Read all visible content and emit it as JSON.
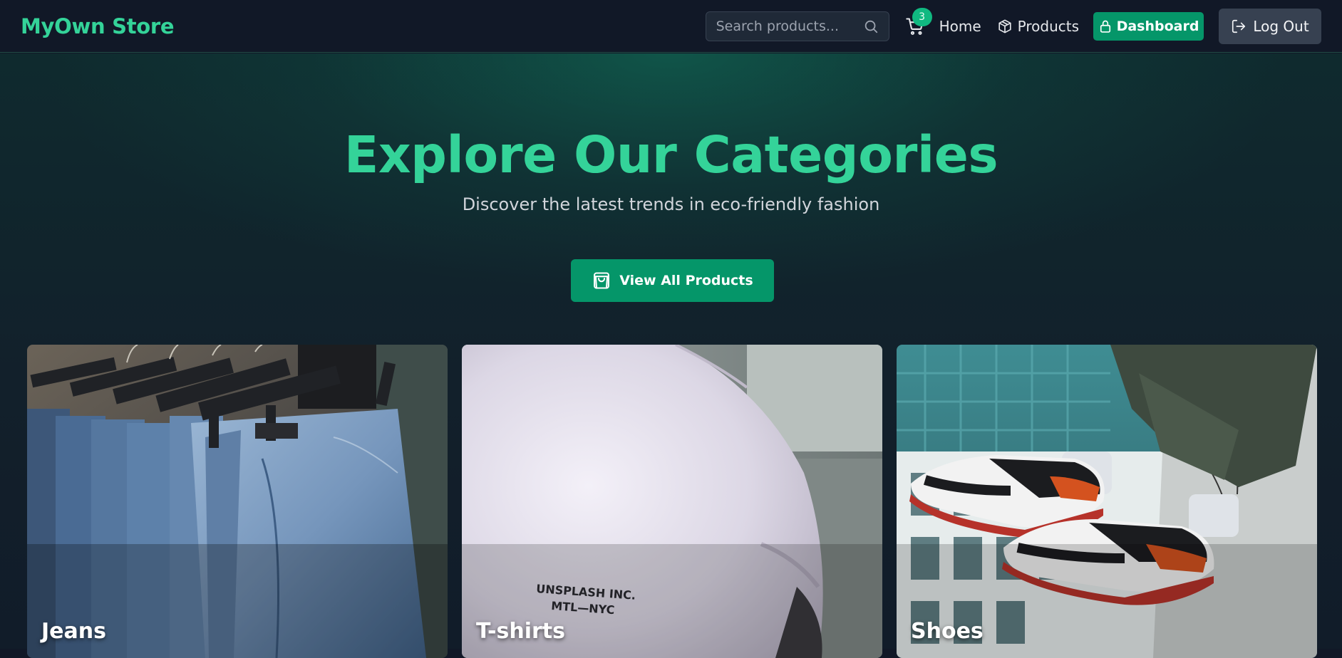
{
  "navbar": {
    "brand": "MyOwn Store",
    "search_placeholder": "Search products...",
    "cart_count": "3",
    "home_label": "Home",
    "products_label": "Products",
    "dashboard_label": "Dashboard",
    "logout_label": "Log Out"
  },
  "hero": {
    "title": "Explore Our Categories",
    "subtitle": "Discover the latest trends in eco-friendly fashion",
    "cta_label": "View All Products"
  },
  "categories": [
    {
      "label": "Jeans"
    },
    {
      "label": "T-shirts",
      "shirt_print_line1": "UNSPLASH INC.",
      "shirt_print_line2": "MTL—NYC"
    },
    {
      "label": "Shoes"
    }
  ],
  "colors": {
    "accent": "#34d399",
    "primary_button": "#059669",
    "background": "#111827",
    "secondary_button": "#374151"
  },
  "icons": {
    "search": "search-icon",
    "cart": "cart-icon",
    "products": "box-icon",
    "dashboard": "lock-icon",
    "logout": "logout-icon",
    "view_all": "shopping-bag-icon"
  }
}
